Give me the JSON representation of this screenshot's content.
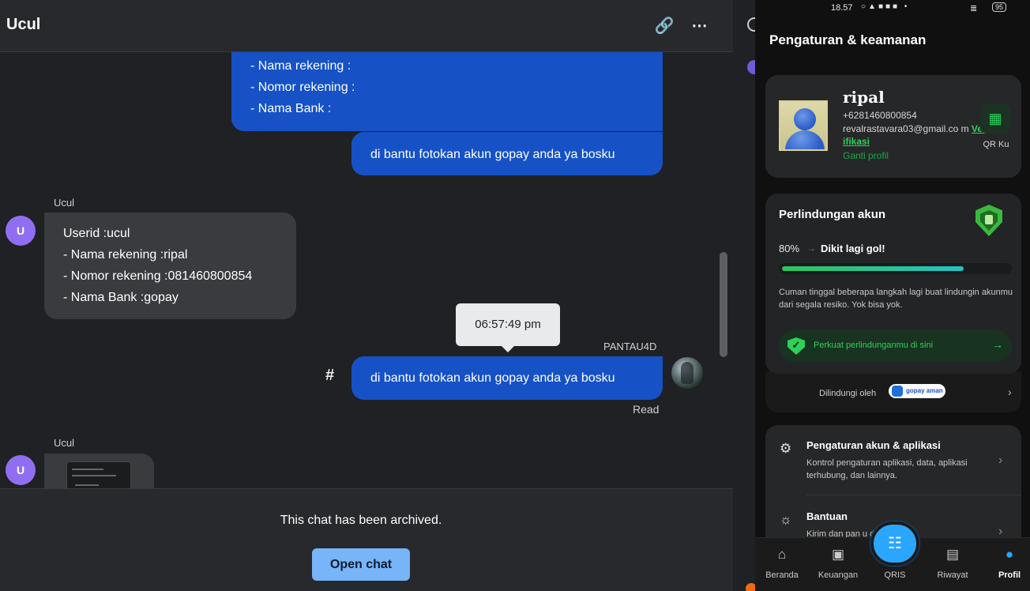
{
  "chat": {
    "title": "Ucul",
    "header_icons": [
      "link-icon",
      "more-icon"
    ],
    "messages": {
      "m1": {
        "lines": [
          "- Nama rekening :",
          "- Nomor rekening :",
          "- Nama Bank :"
        ]
      },
      "m2": {
        "text": "di bantu fotokan akun gopay anda ya bosku"
      },
      "m3": {
        "sender": "Ucul",
        "avatar": "U",
        "lines": [
          "Userid :ucul",
          "- Nama rekening :ripal",
          "- Nomor rekening :081460800854",
          "- Nama Bank :gopay"
        ]
      },
      "m4": {
        "sender": "PANTAU4D",
        "text": "di bantu fotokan akun gopay anda ya bosku",
        "marker": "#",
        "status": "Read",
        "tooltip_time": "06:57:49 pm"
      },
      "m5": {
        "sender": "Ucul",
        "avatar": "U"
      }
    },
    "archive": {
      "text": "This chat has been archived.",
      "button": "Open chat"
    }
  },
  "phone": {
    "statusbar": {
      "time": "18.57",
      "battery": "95"
    },
    "title": "Pengaturan & keamanan",
    "profile": {
      "name": "ripal",
      "phone": "+6281460800854",
      "email": "revalrastavara03@gmail.co m",
      "verify": "Verifikasi",
      "change": "Ganti profil",
      "qr_label": "QR Ku"
    },
    "protection": {
      "title": "Perlindungan akun",
      "percent_label": "80%",
      "progress": 0.8,
      "status": "Dikit lagi gol!",
      "description": "Cuman tinggal beberapa langkah lagi buat lindungin akunmu dari segala resiko. Yok bisa yok.",
      "cta": "Perkuat perlindunganmu di sini",
      "protected_by": "Dilindungi oleh",
      "protected_logo": "gopay aman"
    },
    "settings": [
      {
        "title": "Pengaturan akun & aplikasi",
        "desc": "Kontrol pengaturan aplikasi, data, aplikasi terhubung, dan lainnya."
      },
      {
        "title": "Bantuan",
        "desc": "Kirim dan pan          u di sini."
      }
    ],
    "nav": {
      "beranda": "Beranda",
      "keuangan": "Keuangan",
      "qris": "QRIS",
      "riwayat": "Riwayat",
      "profil": "Profil"
    },
    "colors": {
      "accent_green": "#2fd05a",
      "accent_blue": "#2aa6ff",
      "chat_blue": "#1652c6"
    }
  }
}
